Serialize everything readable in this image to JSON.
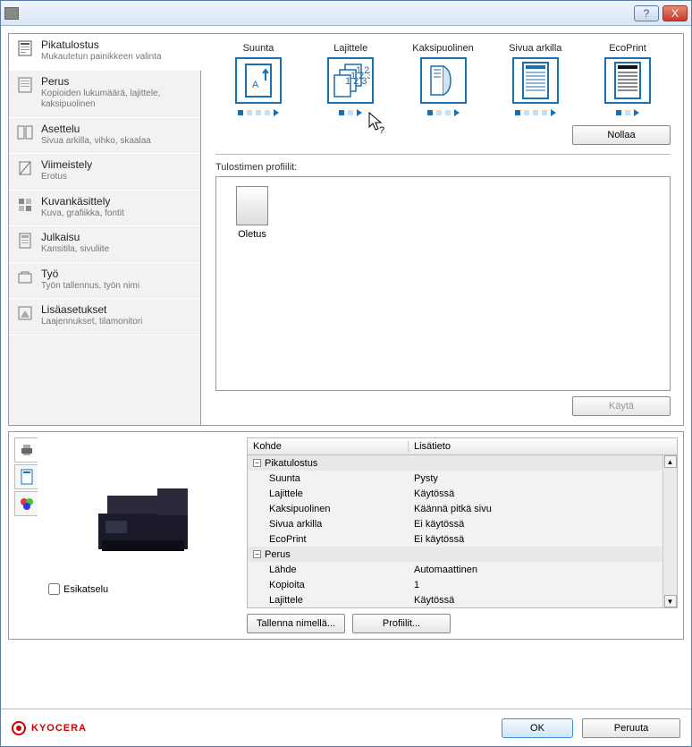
{
  "titlebar": {
    "title": "",
    "help": "?",
    "close": "X"
  },
  "sidebar": {
    "items": [
      {
        "title": "Pikatulostus",
        "desc": "Mukautetun painikkeen valinta"
      },
      {
        "title": "Perus",
        "desc": "Kopioiden lukumäärä, lajittele, kaksipuolinen"
      },
      {
        "title": "Asettelu",
        "desc": "Sivua arkilla, vihko, skaalaa"
      },
      {
        "title": "Viimeistely",
        "desc": "Erotus"
      },
      {
        "title": "Kuvankäsittely",
        "desc": "Kuva, grafiikka, fontit"
      },
      {
        "title": "Julkaisu",
        "desc": "Kansitila, sivuliite"
      },
      {
        "title": "Työ",
        "desc": "Työn tallennus, työn nimi"
      },
      {
        "title": "Lisäasetukset",
        "desc": "Laajennukset, tilamonitori"
      }
    ]
  },
  "quick": {
    "items": [
      {
        "label": "Suunta"
      },
      {
        "label": "Lajittele"
      },
      {
        "label": "Kaksipuolinen"
      },
      {
        "label": "Sivua arkilla"
      },
      {
        "label": "EcoPrint"
      }
    ],
    "reset": "Nollaa"
  },
  "profiles": {
    "label": "Tulostimen profiilit:",
    "items": [
      {
        "name": "Oletus"
      }
    ],
    "apply": "Käytä"
  },
  "preview": {
    "checkbox": "Esikatselu"
  },
  "details": {
    "head1": "Kohde",
    "head2": "Lisätieto",
    "groups": [
      {
        "name": "Pikatulostus",
        "rows": [
          {
            "k": "Suunta",
            "v": "Pysty"
          },
          {
            "k": "Lajittele",
            "v": "Käytössä"
          },
          {
            "k": "Kaksipuolinen",
            "v": "Käännä pitkä sivu"
          },
          {
            "k": "Sivua arkilla",
            "v": "Ei käytössä"
          },
          {
            "k": "EcoPrint",
            "v": "Ei käytössä"
          }
        ]
      },
      {
        "name": "Perus",
        "rows": [
          {
            "k": "Lähde",
            "v": "Automaattinen"
          },
          {
            "k": "Kopioita",
            "v": "1"
          },
          {
            "k": "Lajittele",
            "v": "Käytössä"
          }
        ]
      }
    ],
    "saveAs": "Tallenna nimellä...",
    "profiles": "Profiilit..."
  },
  "footer": {
    "brand": "KYOCERA",
    "ok": "OK",
    "cancel": "Peruuta"
  }
}
